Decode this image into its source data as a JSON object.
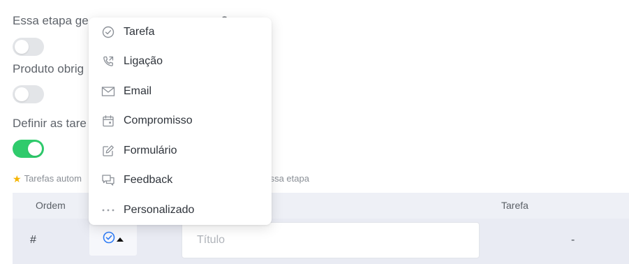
{
  "form": {
    "question_1": "Essa etapa ge",
    "question_1_suffix": "?",
    "question_2": "Produto obrig",
    "question_3": "Definir as tare",
    "toggle_1_on": false,
    "toggle_2_on": false,
    "toggle_3_on": true,
    "note_prefix": "Tarefas autom",
    "note_suffix": "ar nessa etapa"
  },
  "table": {
    "headers": {
      "ordem": "Ordem",
      "tarefa": "Tarefa"
    },
    "row": {
      "index": "#",
      "title_placeholder": "Título",
      "tarefa_value": "-"
    }
  },
  "dropdown": {
    "items": [
      {
        "label": "Tarefa",
        "icon": "check-circle-icon"
      },
      {
        "label": "Ligação",
        "icon": "phone-icon"
      },
      {
        "label": "Email",
        "icon": "mail-icon"
      },
      {
        "label": "Compromisso",
        "icon": "calendar-icon"
      },
      {
        "label": "Formulário",
        "icon": "edit-icon"
      },
      {
        "label": "Feedback",
        "icon": "chat-icon"
      },
      {
        "label": "Personalizado",
        "icon": "more-horizontal-icon"
      }
    ]
  },
  "colors": {
    "accent_blue": "#2f7cf6",
    "toggle_on": "#2fcb6c",
    "star": "#f5b400"
  }
}
